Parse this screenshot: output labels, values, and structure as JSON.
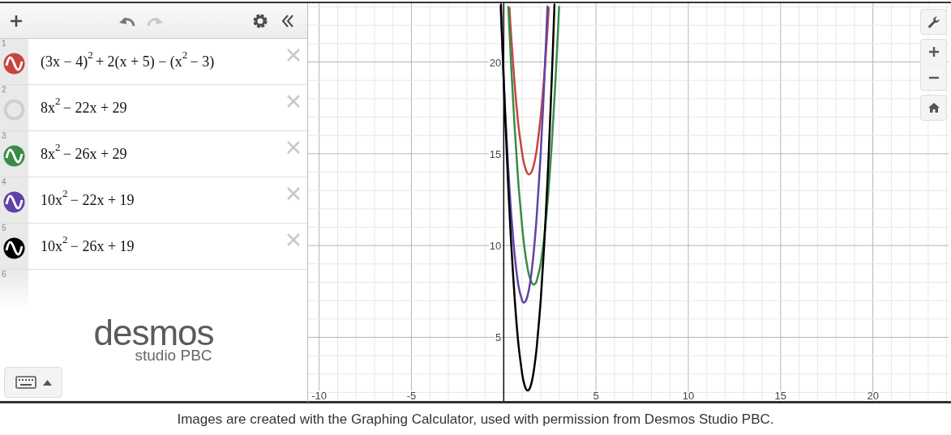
{
  "toolbar": [
    {
      "kind": "add",
      "disabled": false
    },
    {
      "kind": "undo",
      "disabled": false
    },
    {
      "kind": "redo",
      "disabled": true
    },
    {
      "kind": "settings",
      "disabled": false
    },
    {
      "kind": "collapse",
      "disabled": false
    }
  ],
  "expressions": [
    {
      "kind": "expression",
      "number": "1",
      "latex": "(3x − 4)$^{2}$ + 2(x + 5) − (x$^{2}$ − 3)",
      "color": "#c74440",
      "hidden": false
    },
    {
      "kind": "expression",
      "number": "2",
      "latex": "8x$^{2}$ − 22x + 29",
      "hidden": true
    },
    {
      "kind": "expression",
      "number": "3",
      "latex": "8x$^{2}$ − 26x + 29",
      "color": "#388c46",
      "hidden": false
    },
    {
      "kind": "expression",
      "number": "4",
      "latex": "10x$^{2}$ − 22x + 19",
      "color": "#6042a6",
      "hidden": false
    },
    {
      "kind": "expression",
      "number": "5",
      "latex": "10x$^{2}$ − 26x + 19",
      "color": "#000000",
      "hidden": false
    },
    {
      "kind": "blank",
      "number": "6"
    }
  ],
  "logo": {
    "name": "desmos",
    "subtitle": "studio PBC"
  },
  "graph_controls": [
    {
      "kind": "settings"
    },
    {
      "kind": "zoom_in"
    },
    {
      "kind": "zoom_out"
    },
    {
      "kind": "home"
    }
  ],
  "graph": {
    "chart_data": {
      "type": "line",
      "grid": true,
      "x": [
        -0.17,
        -0.15,
        0,
        0.1,
        0.2,
        0.25,
        0.31,
        0.4,
        0.6,
        0.8,
        1.0,
        1.1,
        1.2,
        1.3,
        1.4,
        1.5,
        1.6,
        1.7,
        1.8,
        2.0,
        2.2,
        2.37,
        2.44,
        2.6,
        2.75,
        2.9,
        3.0
      ],
      "series": [
        {
          "color": "#c74440",
          "values": [
            null,
            null,
            null,
            null,
            null,
            null,
            22.95,
            21.48,
            18.68,
            16.52,
            15,
            14.48,
            14.12,
            13.92,
            13.88,
            14,
            14.28,
            14.72,
            15.32,
            17,
            19.32,
            21.8,
            22.95,
            null,
            null,
            null,
            null
          ]
        },
        {
          "color": "#388c46",
          "values": [
            null,
            null,
            null,
            null,
            null,
            23,
            21.71,
            19.88,
            16.28,
            13.32,
            11,
            10.08,
            9.32,
            8.72,
            8.28,
            8,
            7.88,
            7.92,
            8.12,
            9,
            10.52,
            12.32,
            13.19,
            15.48,
            18,
            20.88,
            23
          ]
        },
        {
          "color": "#6042a6",
          "values": [
            23.03,
            22.53,
            19,
            16.9,
            15,
            14.13,
            13.14,
            11.8,
            9.4,
            7.8,
            7,
            6.9,
            7,
            7.3,
            7.8,
            8.5,
            9.4,
            10.5,
            11.8,
            15,
            19,
            23.03,
            null,
            null,
            null,
            null,
            null
          ]
        },
        {
          "color": "#000000",
          "values": [
            null,
            23.13,
            19,
            16.5,
            14.2,
            13.13,
            11.9,
            10.2,
            7,
            4.6,
            3,
            2.5,
            2.2,
            2.1,
            2.2,
            2.5,
            3,
            3.7,
            4.6,
            7,
            10.2,
            13.55,
            15.1,
            19,
            23.13,
            null,
            null
          ]
        }
      ],
      "xlim": [
        -10.6,
        24.1
      ],
      "ylim": [
        1.4,
        23.2
      ],
      "xticks": [
        {
          "value": -10,
          "label": "-10"
        },
        {
          "value": -5,
          "label": "-5"
        },
        {
          "value": 5,
          "label": "5"
        },
        {
          "value": 10,
          "label": "10"
        },
        {
          "value": 15,
          "label": "15"
        },
        {
          "value": 20,
          "label": "20"
        }
      ],
      "yticks": [
        {
          "value": 5,
          "label": "5"
        },
        {
          "value": 10,
          "label": "10"
        },
        {
          "value": 15,
          "label": "15"
        },
        {
          "value": 20,
          "label": "20"
        }
      ]
    }
  },
  "caption": "Images are created with the Graphing Calculator, used with permission from Desmos Studio PBC."
}
